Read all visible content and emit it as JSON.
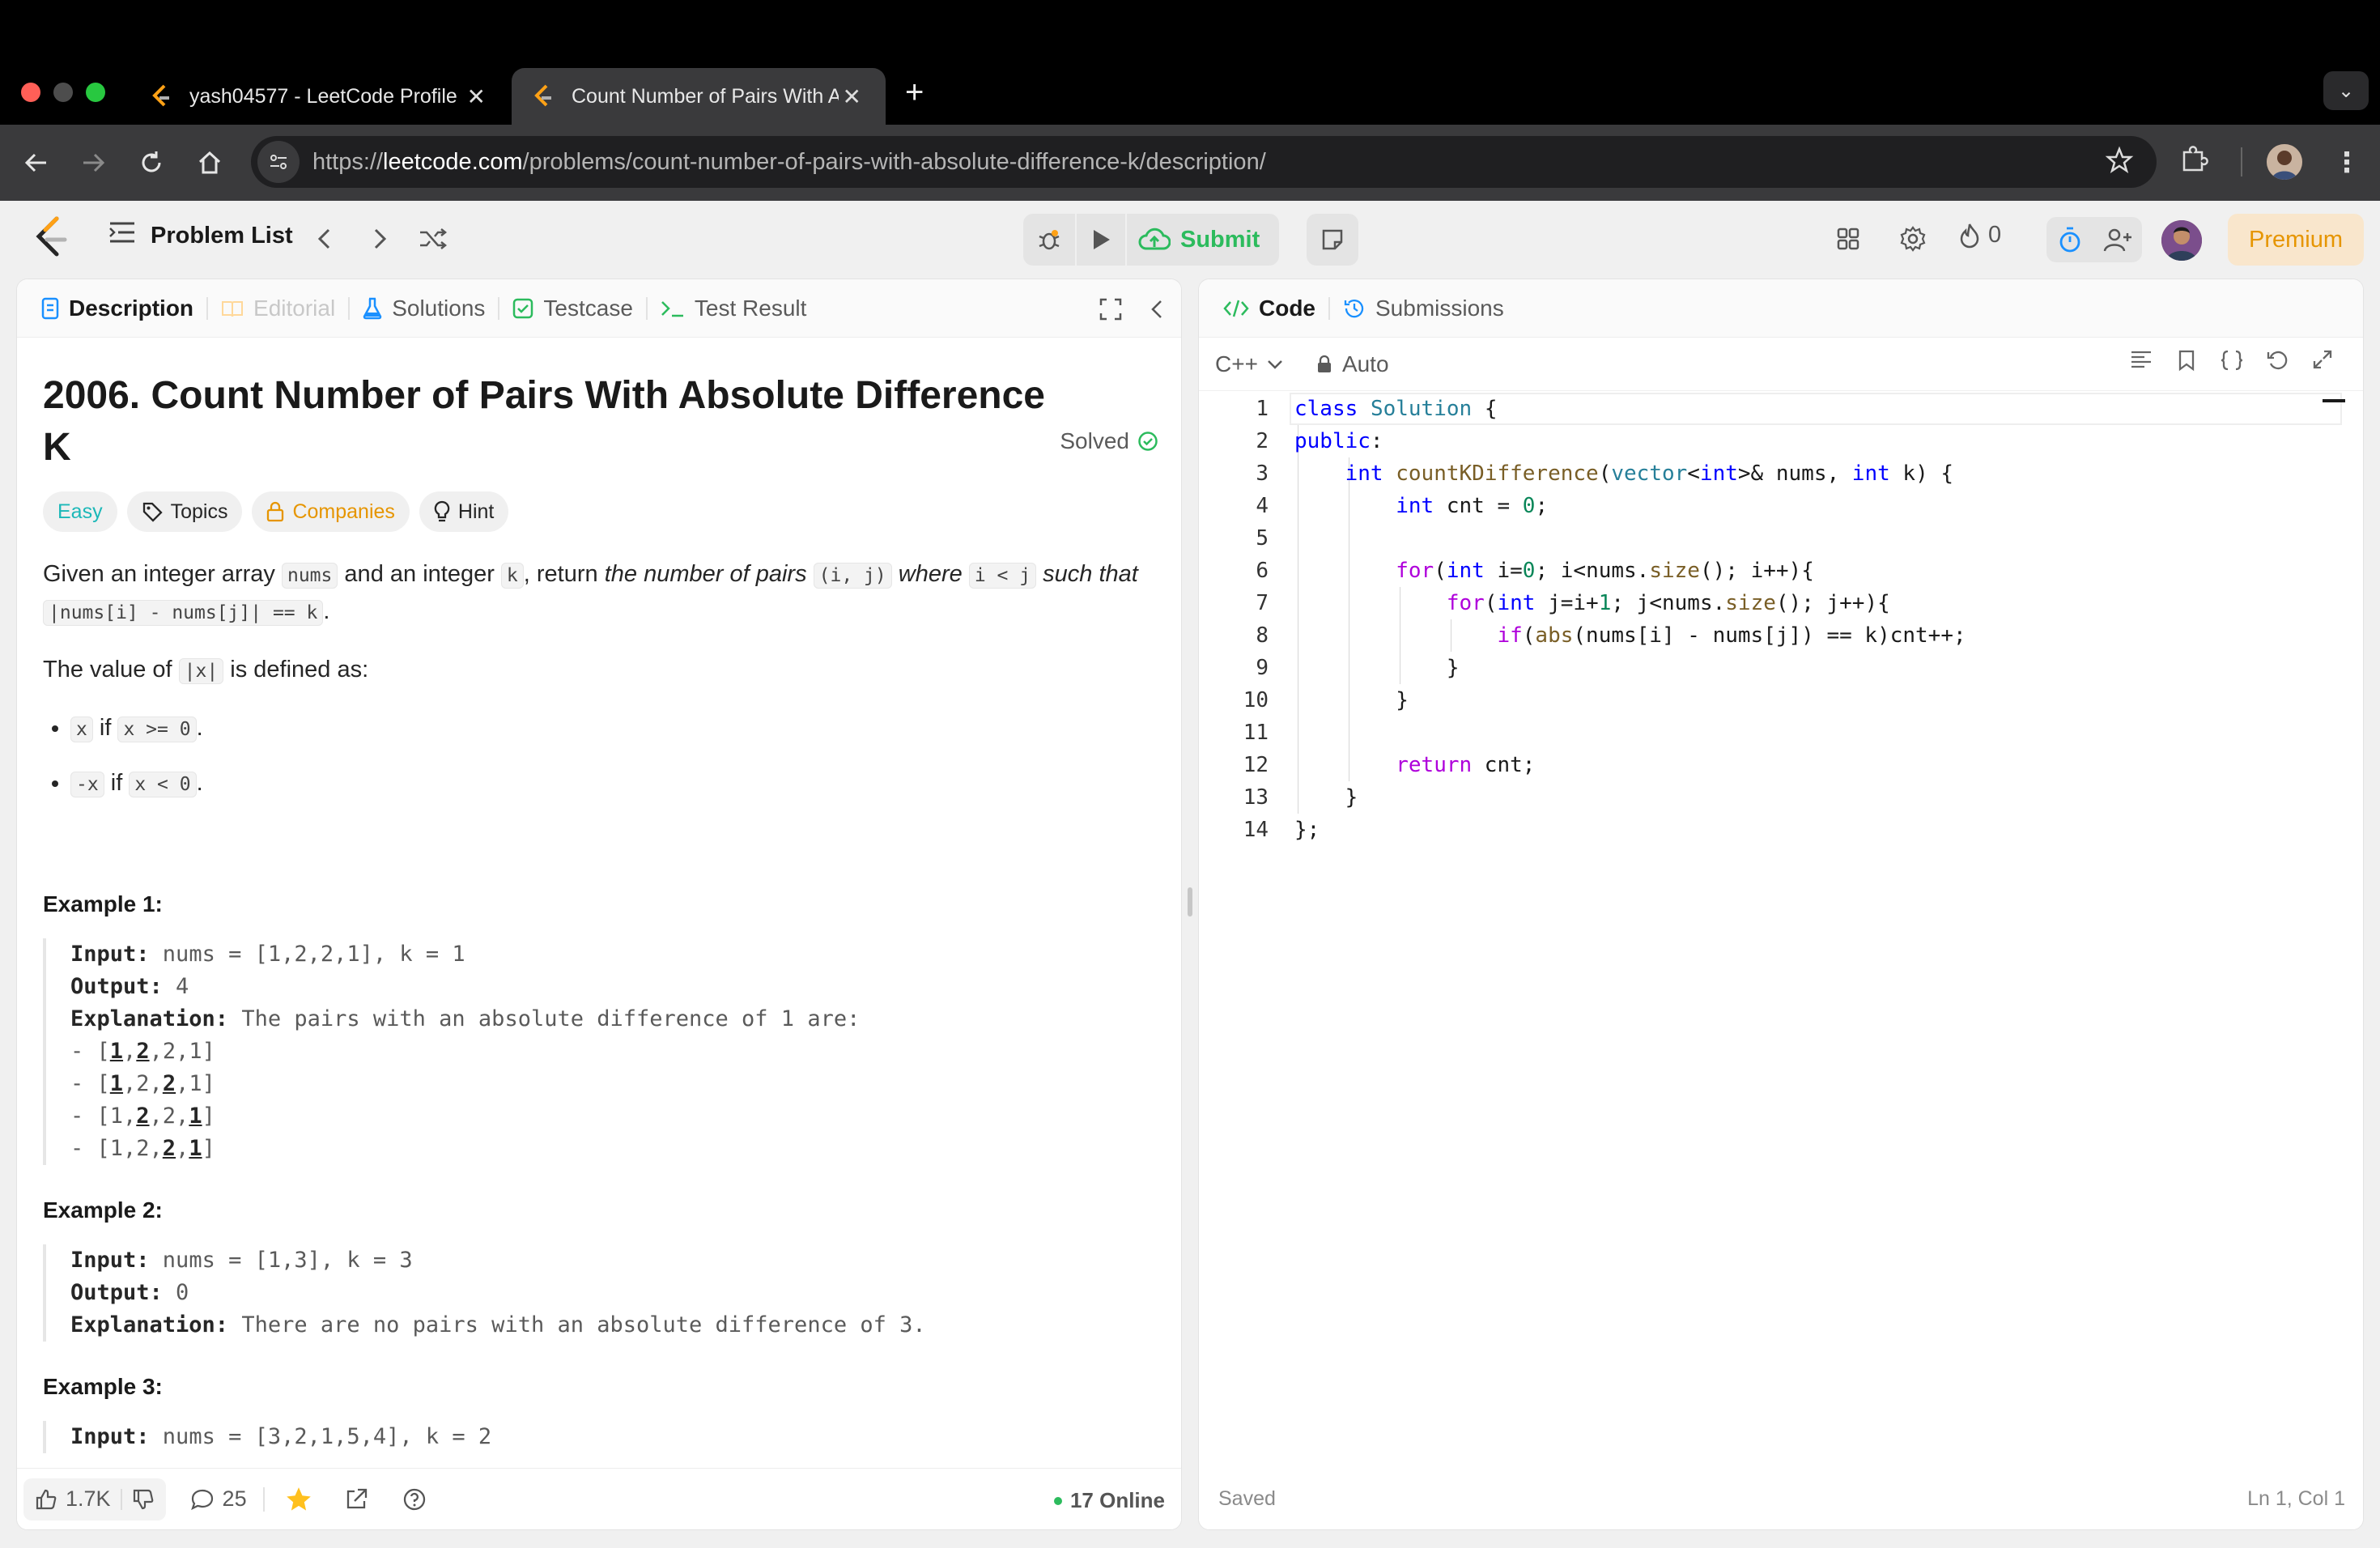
{
  "browser": {
    "tabs": [
      {
        "title": "yash04577 - LeetCode Profile",
        "active": false
      },
      {
        "title": "Count Number of Pairs With Absolute",
        "active": true
      }
    ],
    "url_prefix": "https://",
    "url_host": "leetcode.com",
    "url_path": "/problems/count-number-of-pairs-with-absolute-difference-k/description/"
  },
  "header": {
    "problem_list": "Problem List",
    "submit": "Submit",
    "streak_count": "0",
    "premium": "Premium"
  },
  "left_tabs": {
    "description": "Description",
    "editorial": "Editorial",
    "solutions": "Solutions",
    "testcase": "Testcase",
    "test_result": "Test Result"
  },
  "problem": {
    "title": "2006. Count Number of Pairs With Absolute Difference K",
    "status": "Solved",
    "chips": {
      "difficulty": "Easy",
      "topics": "Topics",
      "companies": "Companies",
      "hint": "Hint"
    },
    "statement": {
      "s1": "Given an integer array ",
      "c1": "nums",
      "s2": " and an integer ",
      "c2": "k",
      "s3": ", return ",
      "i1": "the number of pairs",
      "s4": " ",
      "c3": "(i, j)",
      "s5": " ",
      "i2": "where",
      "s6": " ",
      "c4": "i < j",
      "s7": " ",
      "i3": "such that",
      "s8": " ",
      "c5": "|nums[i] - nums[j]| == k",
      "s9": "."
    },
    "value_def": {
      "s1": "The value of ",
      "c1": "|x|",
      "s2": " is defined as:"
    },
    "defs": [
      {
        "c1": "x",
        "s1": " if ",
        "c2": "x >= 0",
        "s2": "."
      },
      {
        "c1": "-x",
        "s1": " if ",
        "c2": "x < 0",
        "s2": "."
      }
    ],
    "examples": [
      {
        "title": "Example 1:",
        "input_label": "Input:",
        "input": " nums = [1,2,2,1], k = 1",
        "output_label": "Output:",
        "output": " 4",
        "explanation_label": "Explanation:",
        "explanation": " The pairs with an absolute difference of 1 are:",
        "pairs": [
          [
            "- [",
            "1",
            ",",
            "2",
            ",2,1]"
          ],
          [
            "- [",
            "1",
            ",2,",
            "2",
            ",1]"
          ],
          [
            "- [1,",
            "2",
            ",2,",
            "1",
            "]"
          ],
          [
            "- [1,2,",
            "2",
            ",",
            "1",
            "]"
          ]
        ]
      },
      {
        "title": "Example 2:",
        "input_label": "Input:",
        "input": " nums = [1,3], k = 3",
        "output_label": "Output:",
        "output": " 0",
        "explanation_label": "Explanation:",
        "explanation": " There are no pairs with an absolute difference of 3."
      },
      {
        "title": "Example 3:",
        "input_label": "Input:",
        "input": " nums = [3,2,1,5,4], k = 2"
      }
    ]
  },
  "left_footer": {
    "likes": "1.7K",
    "comments": "25",
    "online": "17 Online"
  },
  "right_tabs": {
    "code": "Code",
    "submissions": "Submissions"
  },
  "editor": {
    "language": "C++",
    "mode": "Auto",
    "lines": [
      "1",
      "2",
      "3",
      "4",
      "5",
      "6",
      "7",
      "8",
      "9",
      "10",
      "11",
      "12",
      "13",
      "14"
    ],
    "status_saved": "Saved",
    "cursor": "Ln 1, Col 1"
  },
  "colors": {
    "accent_green": "#2cbb5d",
    "easy": "#1cb8b8",
    "premium": "#e69500"
  }
}
